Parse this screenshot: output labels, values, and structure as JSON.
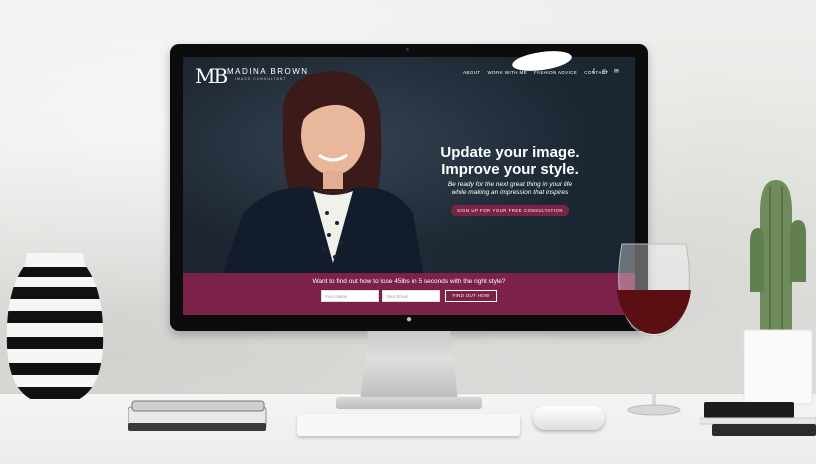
{
  "site": {
    "logo_initials": "MB",
    "brand_name": "MADINA BROWN",
    "brand_tagline": "IMAGE CONSULTANT",
    "nav": [
      "ABOUT",
      "WORK WITH ME",
      "FASHION ADVICE",
      "CONTACT"
    ],
    "social_icons": [
      "facebook-icon",
      "instagram-icon",
      "email-icon"
    ],
    "hero": {
      "headline_line1": "Update your image.",
      "headline_line2": "Improve your style.",
      "subtitle_line1": "Be ready for the next great thing in your life",
      "subtitle_line2": "while making an impression that inspires",
      "cta_label": "SIGN UP FOR YOUR FREE CONSULTATION"
    },
    "optin": {
      "title": "Want to find out how to lose 45lbs in 5 seconds with the right style?",
      "name_placeholder": "Your Name",
      "email_placeholder": "Your Email",
      "submit_label": "FIND OUT HOW"
    }
  },
  "colors": {
    "accent": "#7c2147",
    "screen_bg": "#1c2430"
  }
}
